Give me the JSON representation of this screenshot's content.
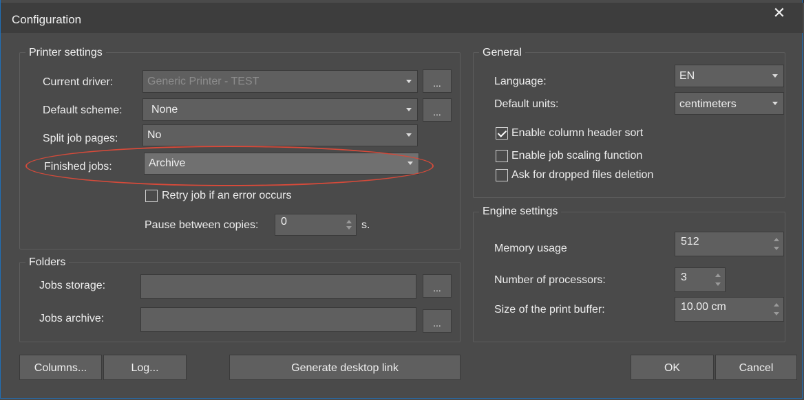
{
  "dialog": {
    "title": "Configuration"
  },
  "printer_settings": {
    "title": "Printer settings",
    "current_driver": {
      "label": "Current driver:",
      "value": "Generic Printer - TEST",
      "browse": "..."
    },
    "default_scheme": {
      "label": "Default scheme:",
      "value": "None",
      "browse": "..."
    },
    "split_job_pages": {
      "label": "Split job pages:",
      "value": "No"
    },
    "finished_jobs": {
      "label": "Finished jobs:",
      "value": "Archive"
    },
    "retry_job": {
      "label": "Retry job if an error occurs",
      "checked": false
    },
    "pause_between_copies": {
      "label": "Pause between copies:",
      "value": "0",
      "unit": "s."
    }
  },
  "folders": {
    "title": "Folders",
    "jobs_storage": {
      "label": "Jobs storage:",
      "value": "",
      "browse": "..."
    },
    "jobs_archive": {
      "label": "Jobs archive:",
      "value": "",
      "browse": "..."
    }
  },
  "general": {
    "title": "General",
    "language": {
      "label": "Language:",
      "value": "EN"
    },
    "default_units": {
      "label": "Default units:",
      "value": "centimeters"
    },
    "enable_column_header_sort": {
      "label": "Enable column header sort",
      "checked": true
    },
    "enable_job_scaling": {
      "label": "Enable job scaling function",
      "checked": false
    },
    "ask_dropped_files_deletion": {
      "label": "Ask for dropped files deletion",
      "checked": false
    }
  },
  "engine_settings": {
    "title": "Engine settings",
    "memory_usage": {
      "label": "Memory usage",
      "value": "512"
    },
    "number_of_processors": {
      "label": "Number of processors:",
      "value": "3"
    },
    "print_buffer": {
      "label": "Size of the print buffer:",
      "value": "10.00 cm"
    }
  },
  "buttons": {
    "columns": "Columns...",
    "log": "Log...",
    "generate_desktop_link": "Generate desktop link",
    "ok": "OK",
    "cancel": "Cancel"
  },
  "colors": {
    "window_bg": "#4a4a4a",
    "titlebar_bg": "#3d3d3d",
    "control_bg": "#5f5f5f",
    "highlight_ellipse": "#d64a3a",
    "window_border": "#1f6fb8"
  },
  "icons": {
    "close": "close-icon",
    "dropdown": "chevron-down-icon",
    "checkbox": "checkbox-icon"
  }
}
